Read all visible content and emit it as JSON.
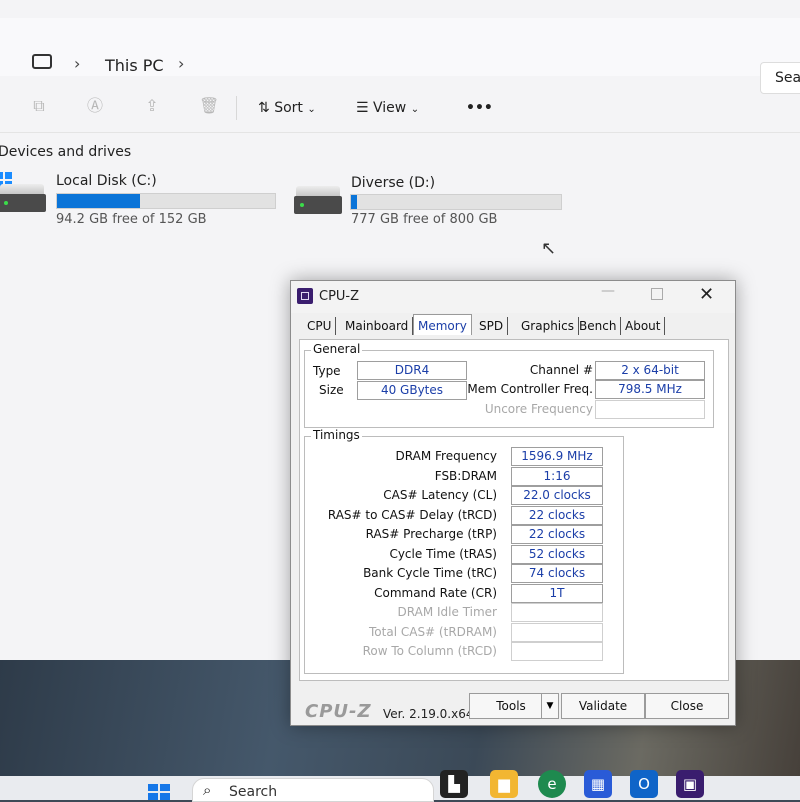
{
  "explorer": {
    "breadcrumb": "This PC",
    "search_label": "Sea",
    "toolbar": {
      "sort_label": "Sort",
      "view_label": "View",
      "more_label": "•••"
    },
    "section_title": "Devices and drives",
    "drives": [
      {
        "name": "Local Disk (C:)",
        "free_text": "94.2 GB free of 152 GB",
        "used_fraction": 0.38
      },
      {
        "name": "Diverse (D:)",
        "free_text": "777 GB free of 800 GB",
        "used_fraction": 0.03
      }
    ]
  },
  "taskbar": {
    "search_label": "Search"
  },
  "cpuz": {
    "title": "CPU-Z",
    "tabs": [
      "CPU",
      "Mainboard",
      "Memory",
      "SPD",
      "Graphics",
      "Bench",
      "About"
    ],
    "active_tab": "Memory",
    "general": {
      "title": "General",
      "type_label": "Type",
      "type_value": "DDR4",
      "size_label": "Size",
      "size_value": "40 GBytes",
      "channel_label": "Channel #",
      "channel_value": "2 x 64-bit",
      "mcf_label": "Mem Controller Freq.",
      "mcf_value": "798.5 MHz",
      "uncore_label": "Uncore Frequency"
    },
    "timings": {
      "title": "Timings",
      "rows": [
        {
          "label": "DRAM Frequency",
          "value": "1596.9 MHz"
        },
        {
          "label": "FSB:DRAM",
          "value": "1:16"
        },
        {
          "label": "CAS# Latency (CL)",
          "value": "22.0 clocks"
        },
        {
          "label": "RAS# to CAS# Delay (tRCD)",
          "value": "22 clocks"
        },
        {
          "label": "RAS# Precharge (tRP)",
          "value": "22 clocks"
        },
        {
          "label": "Cycle Time (tRAS)",
          "value": "52 clocks"
        },
        {
          "label": "Bank Cycle Time (tRC)",
          "value": "74 clocks"
        },
        {
          "label": "Command Rate (CR)",
          "value": "1T"
        },
        {
          "label": "DRAM Idle Timer",
          "value": ""
        },
        {
          "label": "Total CAS# (tRDRAM)",
          "value": ""
        },
        {
          "label": "Row To Column (tRCD)",
          "value": ""
        }
      ]
    },
    "brand": "CPU-Z",
    "version": "Ver. 2.19.0.x64",
    "tools_label": "Tools",
    "validate_label": "Validate",
    "close_label": "Close"
  }
}
